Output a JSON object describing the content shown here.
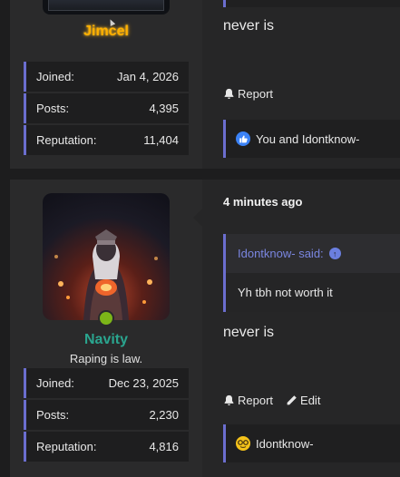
{
  "post1": {
    "username": "Jimcel",
    "message": "never is",
    "stats": [
      {
        "label": "Joined:",
        "value": "Jan 4, 2026"
      },
      {
        "label": "Posts:",
        "value": "4,395"
      },
      {
        "label": "Reputation:",
        "value": "11,404"
      }
    ],
    "actions": {
      "report_label": "Report"
    },
    "reactions": {
      "text": "You and Idontknow-",
      "icon": "like-icon"
    }
  },
  "post2": {
    "username": "Navity",
    "user_title": "Raping is law.",
    "status": "online",
    "time": "4 minutes ago",
    "quote": {
      "author_line": "Idontknow- said:",
      "text": "Yh tbh not worth it"
    },
    "message": "never is",
    "stats": [
      {
        "label": "Joined:",
        "value": "Dec 23, 2025"
      },
      {
        "label": "Posts:",
        "value": "2,230"
      },
      {
        "label": "Reputation:",
        "value": "4,816"
      }
    ],
    "actions": {
      "report_label": "Report",
      "edit_label": "Edit"
    },
    "reactions": {
      "text": "Idontknow-",
      "icon": "nerd-icon"
    }
  },
  "colors": {
    "accent": "#6b6ecf",
    "username_gold": "#ffb000",
    "username_teal": "#2aa58f",
    "online": "#7cb518",
    "quote_author": "#7a86e0"
  }
}
